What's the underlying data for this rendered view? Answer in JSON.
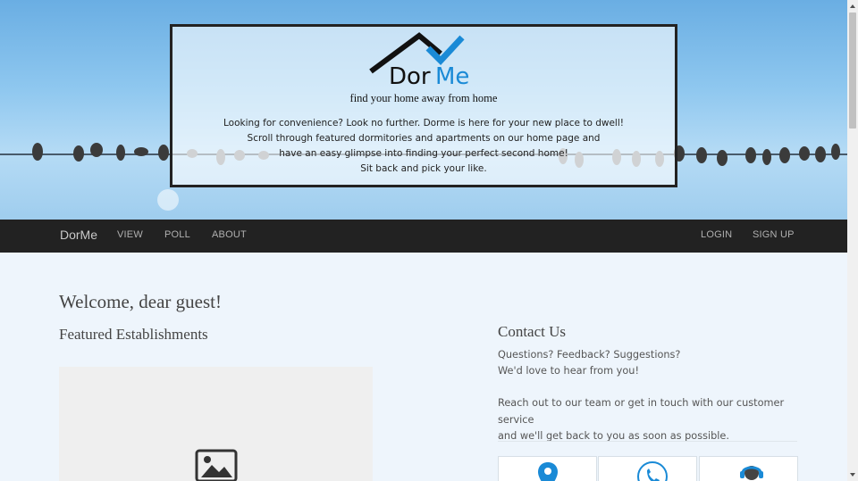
{
  "hero": {
    "logo_text_dor": "Dor",
    "logo_text_me": "Me",
    "tagline": "find your home away from home",
    "intro_lines": [
      "Looking for convenience? Look no further. Dorme is here for your new place to dwell!",
      "Scroll through featured dormitories and apartments on our home page and",
      "have an easy glimpse into finding your perfect second home!",
      "Sit back and pick your like."
    ]
  },
  "navbar": {
    "brand": "DorMe",
    "left_links": [
      "VIEW",
      "POLL",
      "ABOUT"
    ],
    "right_links": [
      "LOGIN",
      "SIGN UP"
    ]
  },
  "main": {
    "welcome": "Welcome, dear guest!",
    "featured_title": "Featured Establishments",
    "placeholder_icon": "image-icon"
  },
  "contact": {
    "title": "Contact Us",
    "line1": "Questions? Feedback? Suggestions?",
    "line2": "We'd love to hear from you!",
    "line3": "Reach out to our team or get in touch with our customer service",
    "line4": "and we'll get back to you as soon as possible.",
    "cards": [
      "location-pin-icon",
      "phone-icon",
      "customer-support-icon"
    ]
  },
  "colors": {
    "navbar_bg": "#222222",
    "accent_blue": "#1a8ad6",
    "page_bg": "#eef5fc"
  }
}
